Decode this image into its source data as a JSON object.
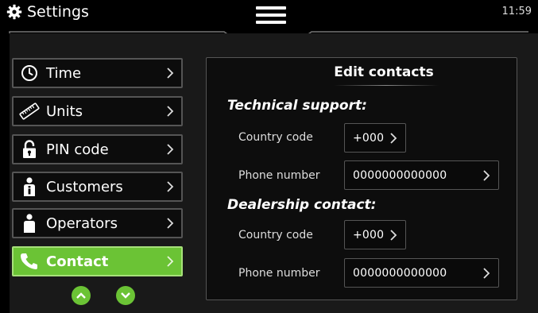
{
  "header": {
    "title": "Settings",
    "clock": "11:59",
    "icons": {
      "settings": "gear-icon",
      "menu": "hamburger-menu-icon"
    }
  },
  "sidebar": {
    "items": [
      {
        "label": "Time",
        "icon": "clock-icon",
        "active": false
      },
      {
        "label": "Units",
        "icon": "ruler-icon",
        "active": false
      },
      {
        "label": "PIN code",
        "icon": "padlock-icon",
        "active": false
      },
      {
        "label": "Customers",
        "icon": "person-info-icon",
        "active": false
      },
      {
        "label": "Operators",
        "icon": "person-icon",
        "active": false
      },
      {
        "label": "Contact",
        "icon": "phone-icon",
        "active": true
      }
    ],
    "scroll": {
      "up": "chevron-up-icon",
      "down": "chevron-down-icon"
    }
  },
  "main": {
    "title": "Edit contacts",
    "sections": [
      {
        "heading": "Technical support:",
        "fields": [
          {
            "label": "Country code",
            "value": "+000"
          },
          {
            "label": "Phone number",
            "value": "0000000000000"
          }
        ]
      },
      {
        "heading": "Dealership contact:",
        "fields": [
          {
            "label": "Country code",
            "value": "+000"
          },
          {
            "label": "Phone number",
            "value": "0000000000000"
          }
        ]
      }
    ]
  },
  "colors": {
    "accent": "#6bc335",
    "accent_border": "#a7e07a",
    "panel": "#191919",
    "background": "#000000",
    "border": "#555555"
  }
}
